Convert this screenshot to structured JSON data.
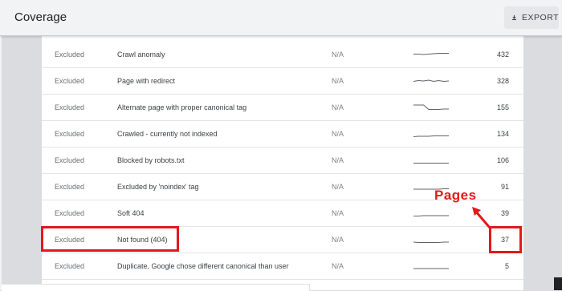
{
  "header": {
    "title": "Coverage",
    "export_label": "EXPORT",
    "export_icon": "download-icon"
  },
  "table": {
    "rows": [
      {
        "status": "Excluded",
        "reason": "Crawl anomaly",
        "validation": "N/A",
        "trend": [
          0.45,
          0.45,
          0.5,
          0.45,
          0.4,
          0.35,
          0.35,
          0.35
        ],
        "pages": "432"
      },
      {
        "status": "Excluded",
        "reason": "Page with redirect",
        "validation": "N/A",
        "trend": [
          0.55,
          0.45,
          0.5,
          0.4,
          0.55,
          0.45,
          0.55,
          0.5
        ],
        "pages": "328"
      },
      {
        "status": "Excluded",
        "reason": "Alternate page with proper canonical tag",
        "validation": "N/A",
        "trend": [
          0.2,
          0.2,
          0.2,
          0.75,
          0.75,
          0.75,
          0.7,
          0.7
        ],
        "pages": "155"
      },
      {
        "status": "Excluded",
        "reason": "Crawled - currently not indexed",
        "validation": "N/A",
        "trend": [
          0.85,
          0.8,
          0.8,
          0.8,
          0.75,
          0.75,
          0.75,
          0.75
        ],
        "pages": "134"
      },
      {
        "status": "Excluded",
        "reason": "Blocked by robots.txt",
        "validation": "N/A",
        "trend": [
          0.85,
          0.85,
          0.85,
          0.85,
          0.85,
          0.85,
          0.85,
          0.85
        ],
        "pages": "106"
      },
      {
        "status": "Excluded",
        "reason": "Excluded by 'noindex' tag",
        "validation": "N/A",
        "trend": [
          0.8,
          0.8,
          0.8,
          0.8,
          0.8,
          0.8,
          0.75,
          0.75
        ],
        "pages": "91"
      },
      {
        "status": "Excluded",
        "reason": "Soft 404",
        "validation": "N/A",
        "trend": [
          0.85,
          0.85,
          0.8,
          0.8,
          0.8,
          0.8,
          0.8,
          0.8
        ],
        "pages": "39"
      },
      {
        "status": "Excluded",
        "reason": "Not found (404)",
        "validation": "N/A",
        "trend": [
          0.8,
          0.85,
          0.85,
          0.85,
          0.85,
          0.85,
          0.8,
          0.8
        ],
        "pages": "37"
      },
      {
        "status": "Excluded",
        "reason": "Duplicate, Google chose different canonical than user",
        "validation": "N/A",
        "trend": [
          0.8,
          0.8,
          0.8,
          0.8,
          0.8,
          0.8,
          0.8,
          0.8
        ],
        "pages": "5"
      }
    ]
  },
  "annotation": {
    "label": "Pages",
    "color": "#e3191b"
  },
  "colors": {
    "header_bg": "#f1f3f4",
    "page_bg": "#dadce0",
    "panel_bg": "#ffffff",
    "sparkline": "#5f6368",
    "highlight": "#e3191b"
  }
}
